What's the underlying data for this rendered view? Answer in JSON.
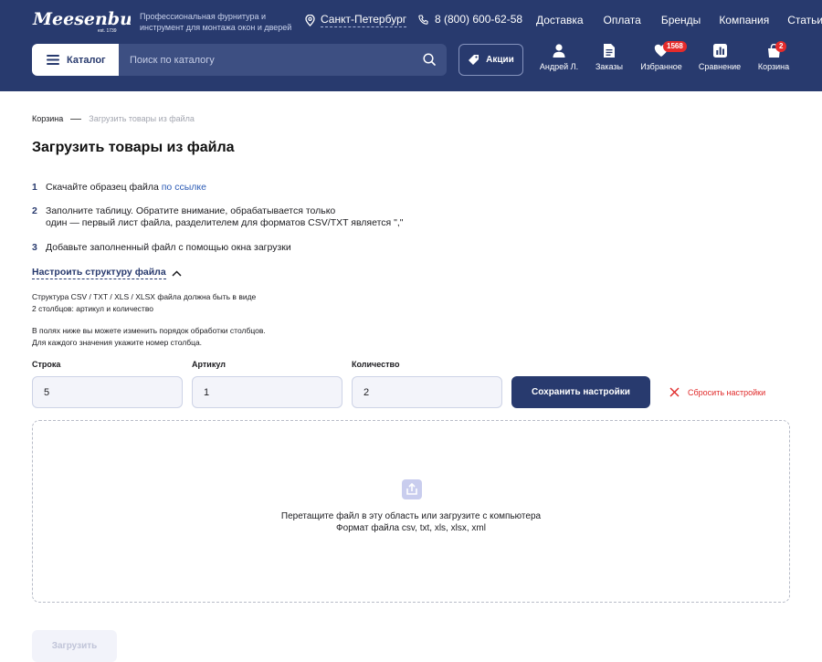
{
  "header": {
    "logo_text": "Meesenburg",
    "logo_sub": "est. 1739",
    "tagline": "Профессиональная фурнитура и инструмент для монтажа окон и дверей",
    "city": "Санкт-Петербург",
    "phone": "8 (800) 600-62-58",
    "nav": [
      "Доставка",
      "Оплата",
      "Бренды",
      "Компания",
      "Статьи"
    ],
    "catalog_label": "Каталог",
    "search_placeholder": "Поиск по каталогу",
    "promo_label": "Акции",
    "user_label": "Андрей Л.",
    "orders_label": "Заказы",
    "favorites_label": "Избранное",
    "favorites_count": "1568",
    "compare_label": "Сравнение",
    "cart_label": "Корзина",
    "cart_count": "2"
  },
  "breadcrumb": {
    "parent": "Корзина",
    "current": "Загрузить товары из файла"
  },
  "page_title": "Загрузить товары из файла",
  "steps": [
    {
      "num": "1",
      "text": "Скачайте образец файла ",
      "link": "по ссылке"
    },
    {
      "num": "2",
      "line1": "Заполните таблицу. Обратите внимание, обрабатывается только",
      "line2": "один — первый лист файла, разделителем для форматов CSV/TXT является \",\""
    },
    {
      "num": "3",
      "text": "Добавьте заполненный файл с помощью окна загрузки"
    }
  ],
  "structure_toggle": "Настроить структуру файла",
  "notes": {
    "n1_line1": "Структура CSV / TXT / XLS / XLSX файла должна быть в виде",
    "n1_line2": "2 столбцов: артикул и количество",
    "n2_line1": "В полях ниже вы можете изменить порядок обработки столбцов.",
    "n2_line2": "Для каждого значения укажите номер столбца."
  },
  "fields": {
    "row_label": "Строка",
    "row_value": "5",
    "article_label": "Артикул",
    "article_value": "1",
    "qty_label": "Количество",
    "qty_value": "2"
  },
  "save_button": "Сохранить настройки",
  "reset_link": "Сбросить настройки",
  "dropzone": {
    "line1": "Перетащите файл в эту область или загрузите с компьютера",
    "line2": "Формат файла csv, txt, xls, xlsx, xml"
  },
  "upload_button": "Загрузить",
  "colors": {
    "brand": "#283a6e",
    "danger": "#e02a2a",
    "link": "#2c5bb5"
  }
}
